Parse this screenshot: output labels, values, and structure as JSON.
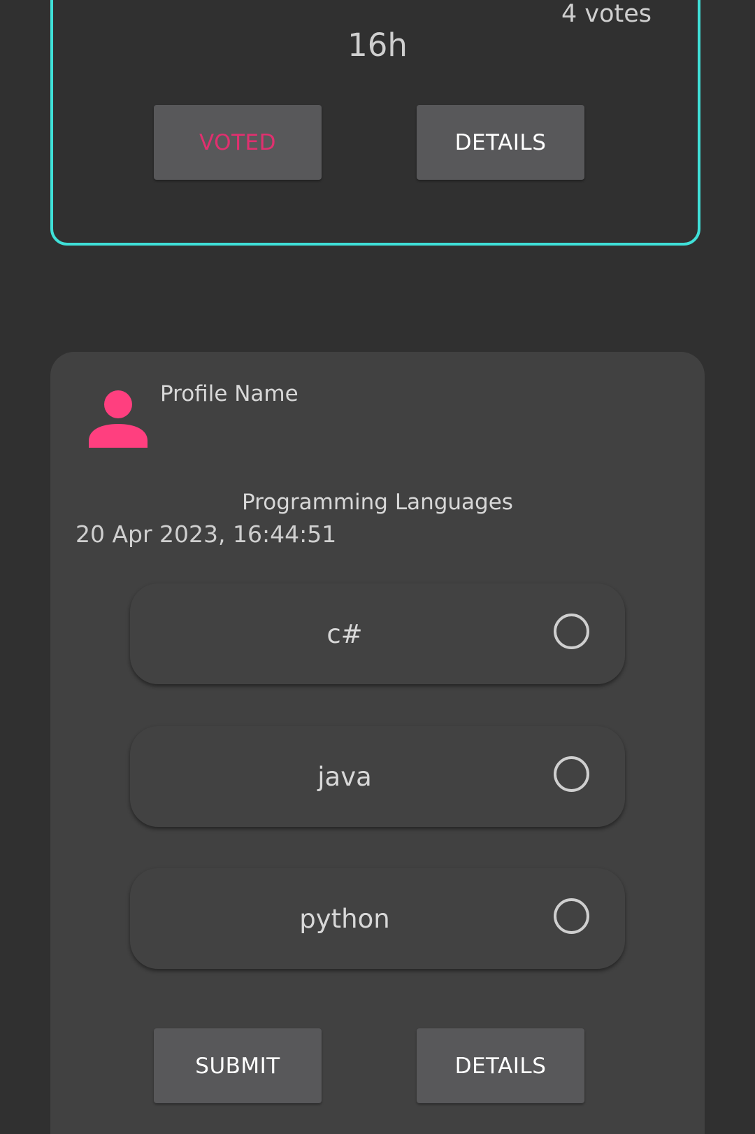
{
  "voted_card": {
    "votes_count": "4 votes",
    "time_left": "16h",
    "voted_label": "VOTED",
    "details_label": "DETAILS",
    "border_color": "#3fe0d8",
    "voted_color": "#e0306f"
  },
  "poll_card": {
    "profile_name": "Profile Name",
    "title": "Programming Languages",
    "date": "20 Apr 2023, 16:44:51",
    "avatar_icon": "person-icon",
    "avatar_color": "#ff3f7f",
    "options": [
      {
        "label": "c#",
        "selected": false
      },
      {
        "label": "java",
        "selected": false
      },
      {
        "label": "python",
        "selected": false
      }
    ],
    "submit_label": "SUBMIT",
    "details_label": "DETAILS"
  }
}
